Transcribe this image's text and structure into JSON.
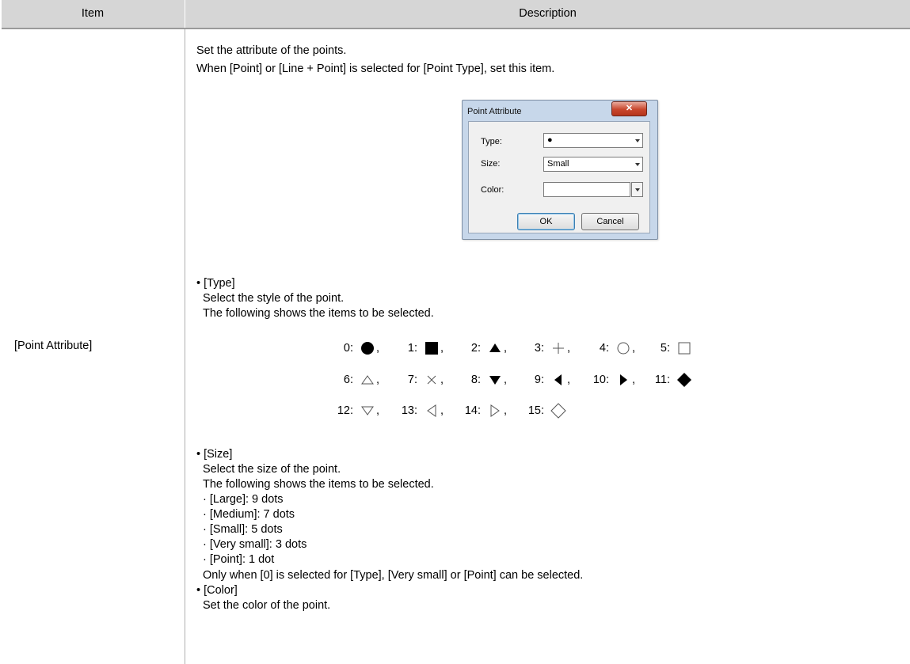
{
  "table": {
    "header_item": "Item",
    "header_description": "Description",
    "item_label": "[Point Attribute]"
  },
  "intro": {
    "line1": "Set the attribute of the points.",
    "line2": "When [Point] or [Line + Point] is selected for [Point Type], set this item."
  },
  "dialog": {
    "title": "Point Attribute",
    "close_icon": "x-close-icon",
    "type_label": "Type:",
    "type_value": "●",
    "size_label": "Size:",
    "size_value": "Small",
    "color_label": "Color:",
    "ok_label": "OK",
    "cancel_label": "Cancel"
  },
  "type_section": {
    "heading": "• [Type]",
    "line1": "Select the style of the point.",
    "line2": "The following shows the items to be selected.",
    "points": [
      {
        "num": "0:",
        "shape": "filled-circle",
        "comma": ","
      },
      {
        "num": "1:",
        "shape": "filled-square",
        "comma": ","
      },
      {
        "num": "2:",
        "shape": "filled-triangle-up",
        "comma": ","
      },
      {
        "num": "3:",
        "shape": "plus",
        "comma": ","
      },
      {
        "num": "4:",
        "shape": "hollow-circle",
        "comma": ","
      },
      {
        "num": "5:",
        "shape": "hollow-square",
        "comma": ""
      },
      {
        "num": "6:",
        "shape": "hollow-triangle-up",
        "comma": ","
      },
      {
        "num": "7:",
        "shape": "cross",
        "comma": ","
      },
      {
        "num": "8:",
        "shape": "filled-triangle-down",
        "comma": ","
      },
      {
        "num": "9:",
        "shape": "filled-triangle-left",
        "comma": ","
      },
      {
        "num": "10:",
        "shape": "filled-triangle-right",
        "comma": ","
      },
      {
        "num": "11:",
        "shape": "filled-diamond",
        "comma": ""
      },
      {
        "num": "12:",
        "shape": "hollow-triangle-down",
        "comma": ","
      },
      {
        "num": "13:",
        "shape": "hollow-triangle-left",
        "comma": ","
      },
      {
        "num": "14:",
        "shape": "hollow-triangle-right",
        "comma": ","
      },
      {
        "num": "15:",
        "shape": "hollow-diamond",
        "comma": ""
      }
    ]
  },
  "size_section": {
    "heading": "• [Size]",
    "line1": "Select the size of the point.",
    "line2": "The following shows the items to be selected.",
    "items": [
      "· [Large]: 9 dots",
      "· [Medium]: 7 dots",
      "· [Small]: 5 dots",
      "· [Very small]: 3 dots",
      "· [Point]: 1 dot"
    ],
    "note": "Only when [0] is selected for [Type], [Very small] or [Point] can be selected."
  },
  "color_section": {
    "heading": "• [Color]",
    "line1": "Set the color of the point."
  }
}
